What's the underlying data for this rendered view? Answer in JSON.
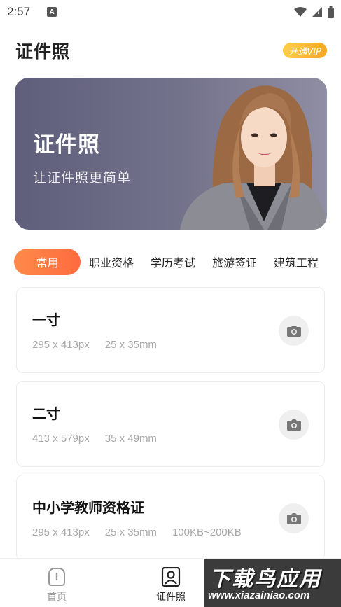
{
  "status_bar": {
    "time": "2:57",
    "notification_badge": "A"
  },
  "header": {
    "title": "证件照",
    "vip_label": "开通VIP"
  },
  "banner": {
    "title": "证件照",
    "subtitle": "让证件照更简单"
  },
  "tabs": [
    {
      "label": "常用",
      "active": true
    },
    {
      "label": "职业资格",
      "active": false
    },
    {
      "label": "学历考试",
      "active": false
    },
    {
      "label": "旅游签证",
      "active": false
    },
    {
      "label": "建筑工程",
      "active": false
    }
  ],
  "cards": [
    {
      "title": "一寸",
      "specs": [
        "295 x 413px",
        "25 x 35mm"
      ]
    },
    {
      "title": "二寸",
      "specs": [
        "413 x 579px",
        "35 x 49mm"
      ]
    },
    {
      "title": "中小学教师资格证",
      "specs": [
        "295 x 413px",
        "25 x 35mm",
        "100KB~200KB"
      ]
    }
  ],
  "bottom_nav": {
    "home_label": "首页",
    "idphoto_label": "证件照"
  },
  "watermark": {
    "main": "下载鸟应用",
    "url": "www.xiazainiao.com"
  },
  "colors": {
    "accent": "#fd6b3e",
    "vip": "#f6a623",
    "banner": "#6b6a85"
  }
}
